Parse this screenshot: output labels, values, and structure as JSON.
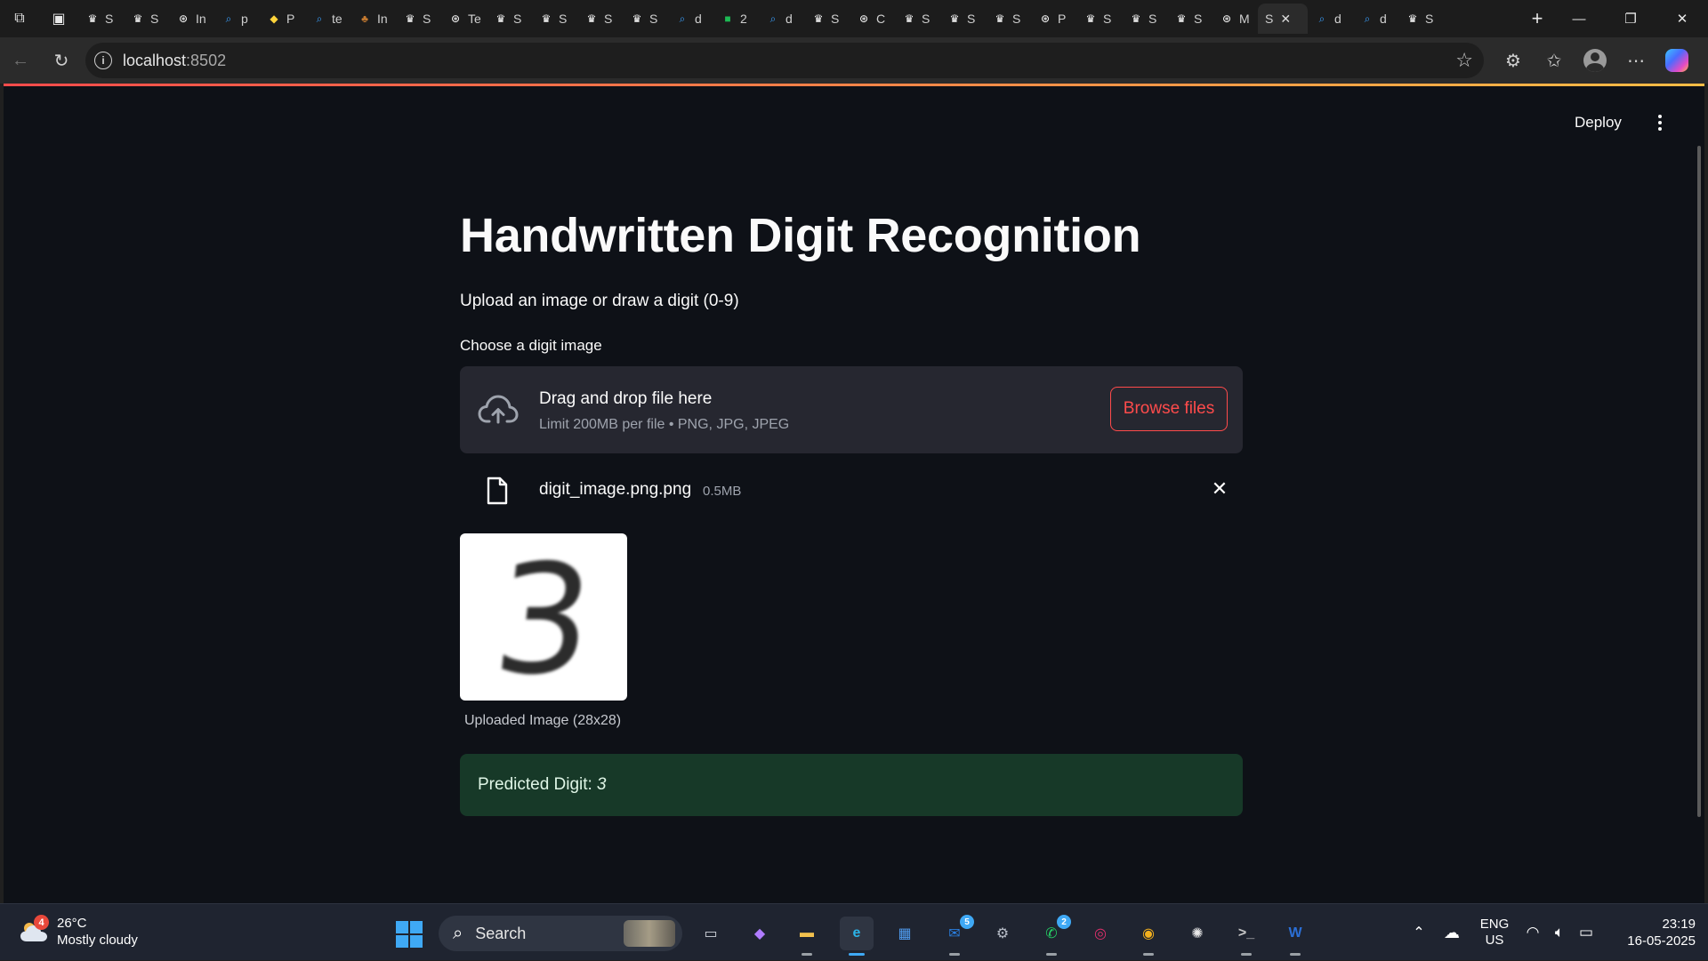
{
  "browser": {
    "tabs": [
      {
        "fav": "crown",
        "label": "S",
        "color": "#ffffff"
      },
      {
        "fav": "crown",
        "label": "S",
        "color": "#ffffff"
      },
      {
        "fav": "openai",
        "label": "In",
        "color": "#ffffff"
      },
      {
        "fav": "search",
        "label": "p",
        "color": "#3aa0ff"
      },
      {
        "fav": "python",
        "label": "P",
        "color": "#ffd43b"
      },
      {
        "fav": "search",
        "label": "te",
        "color": "#3aa0ff"
      },
      {
        "fav": "tree",
        "label": "In",
        "color": "#c77b30"
      },
      {
        "fav": "crown",
        "label": "S",
        "color": "#ffffff"
      },
      {
        "fav": "openai",
        "label": "Te",
        "color": "#ffffff"
      },
      {
        "fav": "crown",
        "label": "S",
        "color": "#ffffff"
      },
      {
        "fav": "crown",
        "label": "S",
        "color": "#ffffff"
      },
      {
        "fav": "crown",
        "label": "S",
        "color": "#ffffff"
      },
      {
        "fav": "crown",
        "label": "S",
        "color": "#ffffff"
      },
      {
        "fav": "search",
        "label": "d",
        "color": "#3aa0ff"
      },
      {
        "fav": "green",
        "label": "2",
        "color": "#1db954"
      },
      {
        "fav": "search",
        "label": "d",
        "color": "#3aa0ff"
      },
      {
        "fav": "crown",
        "label": "S",
        "color": "#ffffff"
      },
      {
        "fav": "openai",
        "label": "C",
        "color": "#ffffff"
      },
      {
        "fav": "crown",
        "label": "S",
        "color": "#ffffff"
      },
      {
        "fav": "crown",
        "label": "S",
        "color": "#ffffff"
      },
      {
        "fav": "crown",
        "label": "S",
        "color": "#ffffff"
      },
      {
        "fav": "openai",
        "label": "P",
        "color": "#ffffff"
      },
      {
        "fav": "crown",
        "label": "S",
        "color": "#ffffff"
      },
      {
        "fav": "crown",
        "label": "S",
        "color": "#ffffff"
      },
      {
        "fav": "crown",
        "label": "S",
        "color": "#ffffff"
      },
      {
        "fav": "openai",
        "label": "M",
        "color": "#ffffff"
      },
      {
        "fav": "none",
        "label": "S",
        "color": "#ffffff",
        "active": true
      },
      {
        "fav": "search",
        "label": "d",
        "color": "#3aa0ff"
      },
      {
        "fav": "search",
        "label": "d",
        "color": "#3aa0ff"
      },
      {
        "fav": "crown",
        "label": "S",
        "color": "#ffffff"
      }
    ],
    "url_host": "localhost",
    "url_port": ":8502"
  },
  "app": {
    "deploy_label": "Deploy",
    "title": "Handwritten Digit Recognition",
    "subtitle": "Upload an image or draw a digit (0-9)",
    "uploader_label": "Choose a digit image",
    "dropzone_title": "Drag and drop file here",
    "dropzone_sub": "Limit 200MB per file • PNG, JPG, JPEG",
    "browse_label": "Browse files",
    "file_name": "digit_image.png.png",
    "file_size": "0.5MB",
    "image_digit": "3",
    "image_caption": "Uploaded Image (28x28)",
    "prediction_label": "Predicted Digit:",
    "prediction_value": "3",
    "accent_color": "#ff4b4b",
    "success_bg": "#173928"
  },
  "taskbar": {
    "weather_badge": "4",
    "temperature": "26°C",
    "condition": "Mostly cloudy",
    "search_label": "Search",
    "apps": [
      {
        "name": "task-view",
        "label": "▭"
      },
      {
        "name": "copilot-app",
        "label": "◆"
      },
      {
        "name": "file-explorer",
        "label": "▬"
      },
      {
        "name": "edge",
        "label": "e",
        "active": true
      },
      {
        "name": "microsoft-store",
        "label": "▦"
      },
      {
        "name": "outlook",
        "label": "✉",
        "badge": "5"
      },
      {
        "name": "settings",
        "label": "⚙"
      },
      {
        "name": "whatsapp",
        "label": "✆",
        "badge": "2"
      },
      {
        "name": "instagram",
        "label": "◎"
      },
      {
        "name": "chrome",
        "label": "◉"
      },
      {
        "name": "chatgpt",
        "label": "✺"
      },
      {
        "name": "terminal",
        "label": ">_"
      },
      {
        "name": "word",
        "label": "W"
      }
    ],
    "lang_top": "ENG",
    "lang_bottom": "US",
    "time": "23:19",
    "date": "16-05-2025"
  }
}
